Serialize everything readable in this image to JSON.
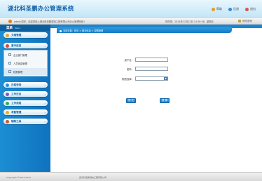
{
  "header": {
    "title": "湖北科圣鹏办公管理系统",
    "links": [
      {
        "label": "帮助",
        "color": "#e39b24"
      },
      {
        "label": "后退",
        "color": "#3a86d1"
      },
      {
        "label": "退出",
        "color": "#d9534f"
      }
    ]
  },
  "infobar": {
    "welcome": "admin您好，欢迎您进入湖北科圣鹏弱电工程有限公司办公管理系统！",
    "datetime": "现在是：2014年12月22日 14:30:36，星期五",
    "change_password": "修改密码"
  },
  "sidebar": {
    "menu_title": "菜单",
    "menu_subtitle": "Menu",
    "items": [
      {
        "label": "文档管理",
        "color": "#e9a23b"
      },
      {
        "label": "基本信息",
        "color": "#d64a3b"
      },
      {
        "label": "日程安排",
        "color": "#2c8fd6"
      },
      {
        "label": "工作日志",
        "color": "#7a5bc2"
      },
      {
        "label": "工作流程",
        "color": "#39a85a"
      },
      {
        "label": "考勤管理",
        "color": "#e0b12f"
      },
      {
        "label": "辅助工具",
        "color": "#d05a2a"
      }
    ],
    "subitems": [
      {
        "label": "企业部门管理"
      },
      {
        "label": "人员信息管理"
      },
      {
        "label": "权限管理"
      }
    ]
  },
  "breadcrumb": {
    "text": "当前位置：首页 > 基本信息 > 权限管理"
  },
  "form": {
    "username_label": "用户名：",
    "username_value": "",
    "password_label": "密码：",
    "password_value": "",
    "role_label": "权限选择：",
    "role_value": "",
    "submit_label": "提 交",
    "reset_label": "重 置"
  },
  "footer": {
    "copyright": "Copyright ©2014-2015",
    "company": "武汉科圣鹏弱电工程有限公司"
  }
}
